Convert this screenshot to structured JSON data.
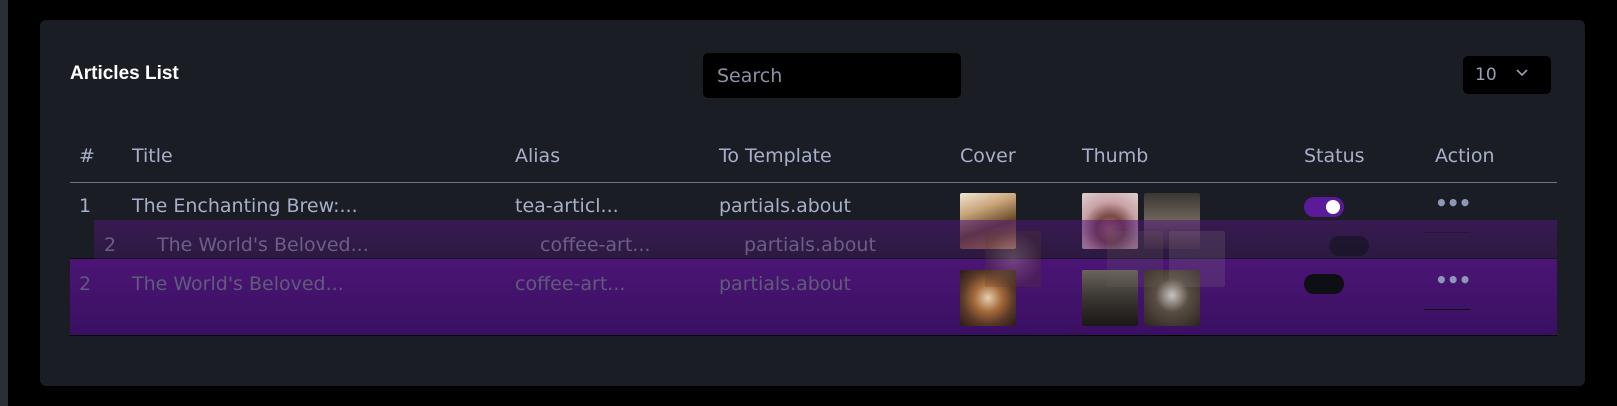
{
  "header": {
    "title": "Articles List",
    "search_placeholder": "Search",
    "page_size": "10"
  },
  "table": {
    "columns": [
      "#",
      "Title",
      "Alias",
      "To Template",
      "Cover",
      "Thumb",
      "Status",
      "Action"
    ],
    "rows": [
      {
        "num": "1",
        "title": "The Enchanting Brew:...",
        "alias": "tea-articl...",
        "template": "partials.about",
        "status": "on"
      },
      {
        "num": "2",
        "title": "The World's Beloved...",
        "alias": "coffee-art...",
        "template": "partials.about",
        "status": "off"
      }
    ],
    "drag_ghost": {
      "num": "2",
      "title": "The World's Beloved...",
      "alias": "coffee-art...",
      "template": "partials.about"
    },
    "action_label": "•••"
  },
  "colors": {
    "accent": "#5b1a9a",
    "card": "#1b1d25",
    "text": "#a7afc9"
  }
}
